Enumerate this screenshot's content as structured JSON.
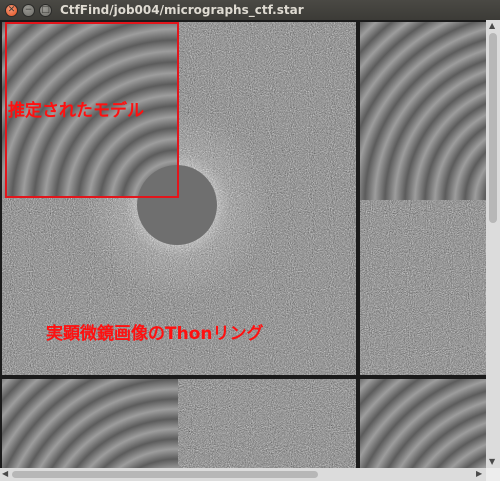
{
  "window": {
    "title": "CtfFind/job004/micrographs_ctf.star",
    "close_glyph": "✕",
    "minimize_glyph": "−",
    "maximize_glyph": "□"
  },
  "annotations": {
    "model_label": "推定されたモデル",
    "thon_label": "実顕微鏡画像のThonリング",
    "color": "#ff1010"
  },
  "scrollbars": {
    "up_glyph": "▲",
    "down_glyph": "▼",
    "left_glyph": "◀",
    "right_glyph": "▶"
  }
}
